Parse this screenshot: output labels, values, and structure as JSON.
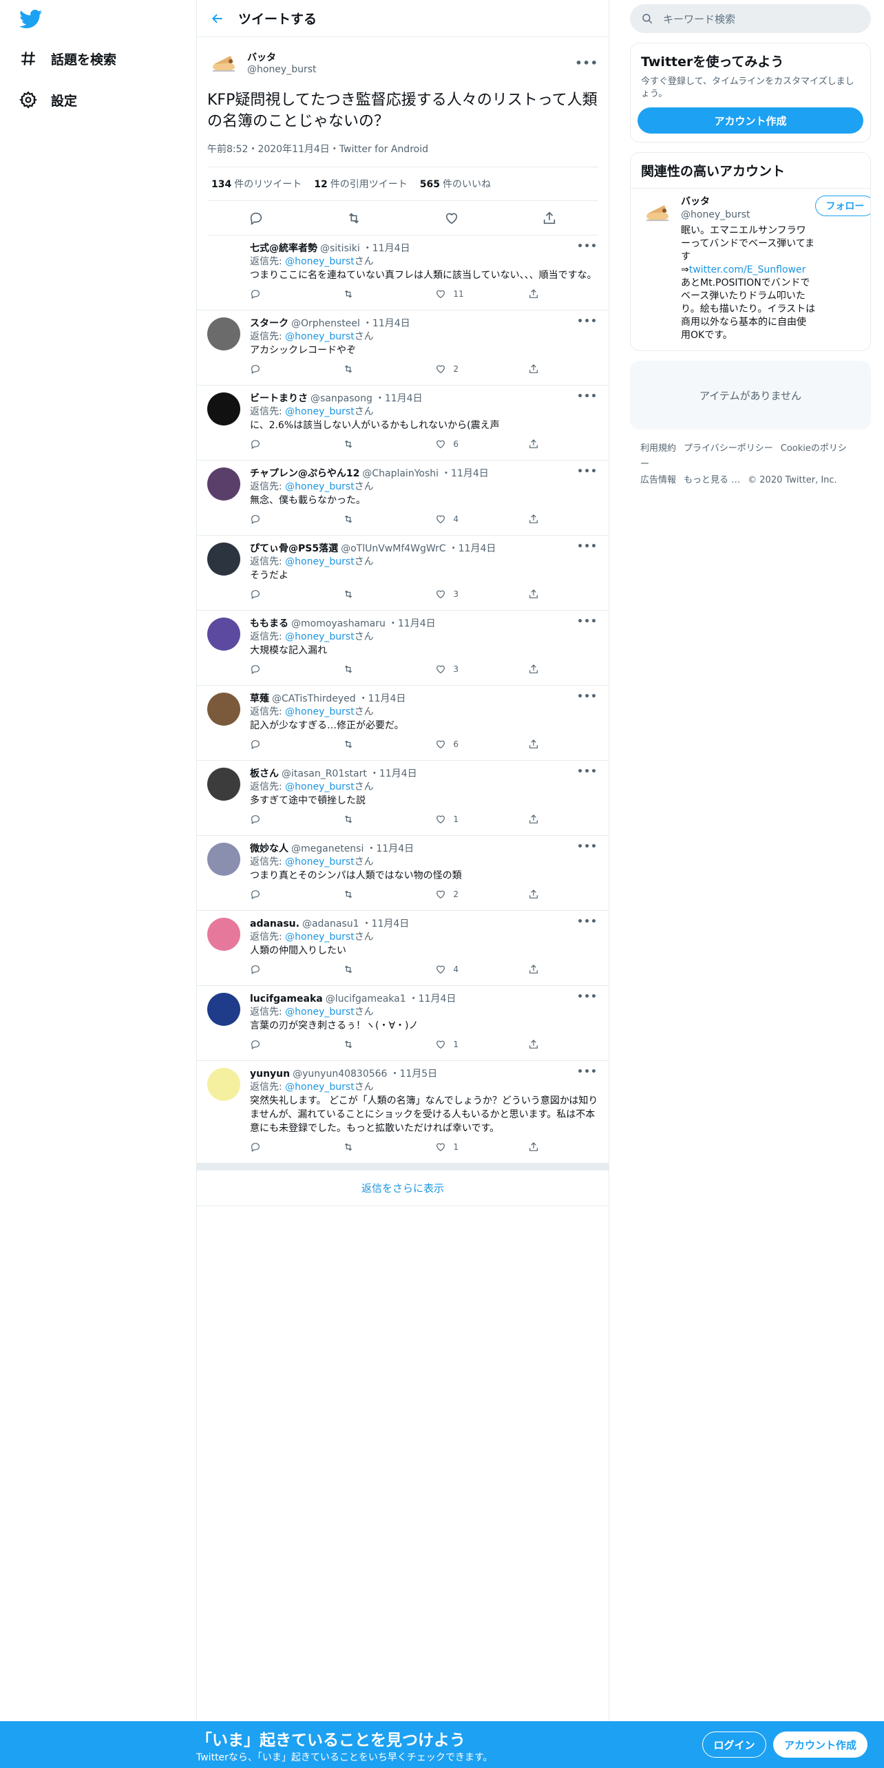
{
  "nav": {
    "explore": "話題を検索",
    "settings": "設定"
  },
  "header": {
    "title": "ツイートする"
  },
  "focal": {
    "name": "バッタ",
    "handle": "@honey_burst",
    "text": "KFP疑問視してたつき監督応援する人々のリストって人類の名簿のことじゃないの？",
    "meta": "午前8:52・2020年11月4日・Twitter for Android",
    "retweets_count": "134",
    "retweets_label": "件のリツイート",
    "quotes_count": "12",
    "quotes_label": "件の引用ツイート",
    "likes_count": "565",
    "likes_label": "件のいいね"
  },
  "replies": [
    {
      "name": "七式@統率者勢",
      "handle": "@sitisiki",
      "date": "・11月4日",
      "to": "返信先:",
      "to_handle": "@honey_burst",
      "to_suffix": "さん",
      "text": "つまりここに名を連ねていない真フレは人類に該当していない、、、順当ですな。",
      "likes": "11",
      "avatar_color": "#ffffff"
    },
    {
      "name": "スターク",
      "handle": "@Orphensteel",
      "date": "・11月4日",
      "to": "返信先:",
      "to_handle": "@honey_burst",
      "to_suffix": "さん",
      "text": "アカシックレコードやぞ",
      "likes": "2",
      "avatar_color": "#6b6b6b"
    },
    {
      "name": "ビートまりさ",
      "handle": "@sanpasong",
      "date": "・11月4日",
      "to": "返信先:",
      "to_handle": "@honey_burst",
      "to_suffix": "さん",
      "text": "に、2.6%は該当しない人がいるかもしれないから(震え声",
      "likes": "6",
      "avatar_color": "#111111"
    },
    {
      "name": "チャプレン@ぷらやん12",
      "handle": "@ChaplainYoshi",
      "date": "・11月4日",
      "to": "返信先:",
      "to_handle": "@honey_burst",
      "to_suffix": "さん",
      "text": "無念、僕も載らなかった。",
      "likes": "4",
      "avatar_color": "#5a3f6b"
    },
    {
      "name": "ぴてぃ骨@PS5落選",
      "handle": "@oTlUnVwMf4WgWrC",
      "date": "・11月4日",
      "to": "返信先:",
      "to_handle": "@honey_burst",
      "to_suffix": "さん",
      "text": "そうだよ",
      "likes": "3",
      "avatar_color": "#2c3440"
    },
    {
      "name": "ももまる",
      "handle": "@momoyashamaru",
      "date": "・11月4日",
      "to": "返信先:",
      "to_handle": "@honey_burst",
      "to_suffix": "さん",
      "text": "大規模な記入漏れ",
      "likes": "3",
      "avatar_color": "#5b4aa0"
    },
    {
      "name": "草薙",
      "handle": "@CATisThirdeyed",
      "date": "・11月4日",
      "to": "返信先:",
      "to_handle": "@honey_burst",
      "to_suffix": "さん",
      "text": "記入が少なすぎる…修正が必要だ。",
      "likes": "6",
      "avatar_color": "#7a5a3a"
    },
    {
      "name": "板さん",
      "handle": "@itasan_R01start",
      "date": "・11月4日",
      "to": "返信先:",
      "to_handle": "@honey_burst",
      "to_suffix": "さん",
      "text": "多すぎて途中で頓挫した説",
      "likes": "1",
      "avatar_color": "#3c3c3c"
    },
    {
      "name": "微妙な人",
      "handle": "@meganetensi",
      "date": "・11月4日",
      "to": "返信先:",
      "to_handle": "@honey_burst",
      "to_suffix": "さん",
      "text": "つまり真とそのシンパは人類ではない物の怪の類",
      "likes": "2",
      "avatar_color": "#8a8fb0"
    },
    {
      "name": "adanasu.",
      "handle": "@adanasu1",
      "date": "・11月4日",
      "to": "返信先:",
      "to_handle": "@honey_burst",
      "to_suffix": "さん",
      "text": "人類の仲間入りしたい",
      "likes": "4",
      "avatar_color": "#e6789c"
    },
    {
      "name": "lucifgameaka",
      "handle": "@lucifgameaka1",
      "date": "・11月4日",
      "to": "返信先:",
      "to_handle": "@honey_burst",
      "to_suffix": "さん",
      "text": "言葉の刃が突き刺さるぅ！ヽ(・∀・)ノ",
      "likes": "1",
      "avatar_color": "#1e3c8a"
    },
    {
      "name": "yunyun",
      "handle": "@yunyun40830566",
      "date": "・11月5日",
      "to": "返信先:",
      "to_handle": "@honey_burst",
      "to_suffix": "さん",
      "text": "突然失礼します。 どこが「人類の名簿」なんでしょうか？どういう意図かは知りませんが、漏れていることにショックを受ける人もいるかと思います。私は不本意にも未登録でした。もっと拡散いただければ幸いです。",
      "likes": "1",
      "avatar_color": "#f5f0a0"
    }
  ],
  "show_more": "返信をさらに表示",
  "search": {
    "placeholder": "キーワード検索"
  },
  "signup_card": {
    "title": "Twitterを使ってみよう",
    "sub": "今すぐ登録して、タイムラインをカスタマイズしましょう。",
    "button": "アカウント作成"
  },
  "related": {
    "title": "関連性の高いアカウント",
    "name": "バッタ",
    "handle": "@honey_burst",
    "follow": "フォロー",
    "bio1": "眠い。エマニエルサンフラワーってバンドでベース弾いてます",
    "bio_link_prefix": "⇒",
    "bio_link": "twitter.com/E_Sunflower",
    "bio2": "　あとMt.POSITIONでバンドでベース弾いたりドラム叩いたり。絵も描いたり。イラストは商用以外なら基本的に自由使用OKです。"
  },
  "empty_box": "アイテムがありません",
  "footer": [
    "利用規約",
    "プライバシーポリシー",
    "Cookieのポリシー",
    "広告情報",
    "もっと見る …",
    "© 2020 Twitter, Inc."
  ],
  "bottom": {
    "title": "「いま」起きていることを見つけよう",
    "sub": "Twitterなら、「いま」起きていることをいち早くチェックできます。",
    "login": "ログイン",
    "signup": "アカウント作成"
  },
  "colors": {
    "accent": "#1da1f2",
    "link": "#1b95e0",
    "muted": "#536471",
    "border": "#e6ecf0"
  }
}
